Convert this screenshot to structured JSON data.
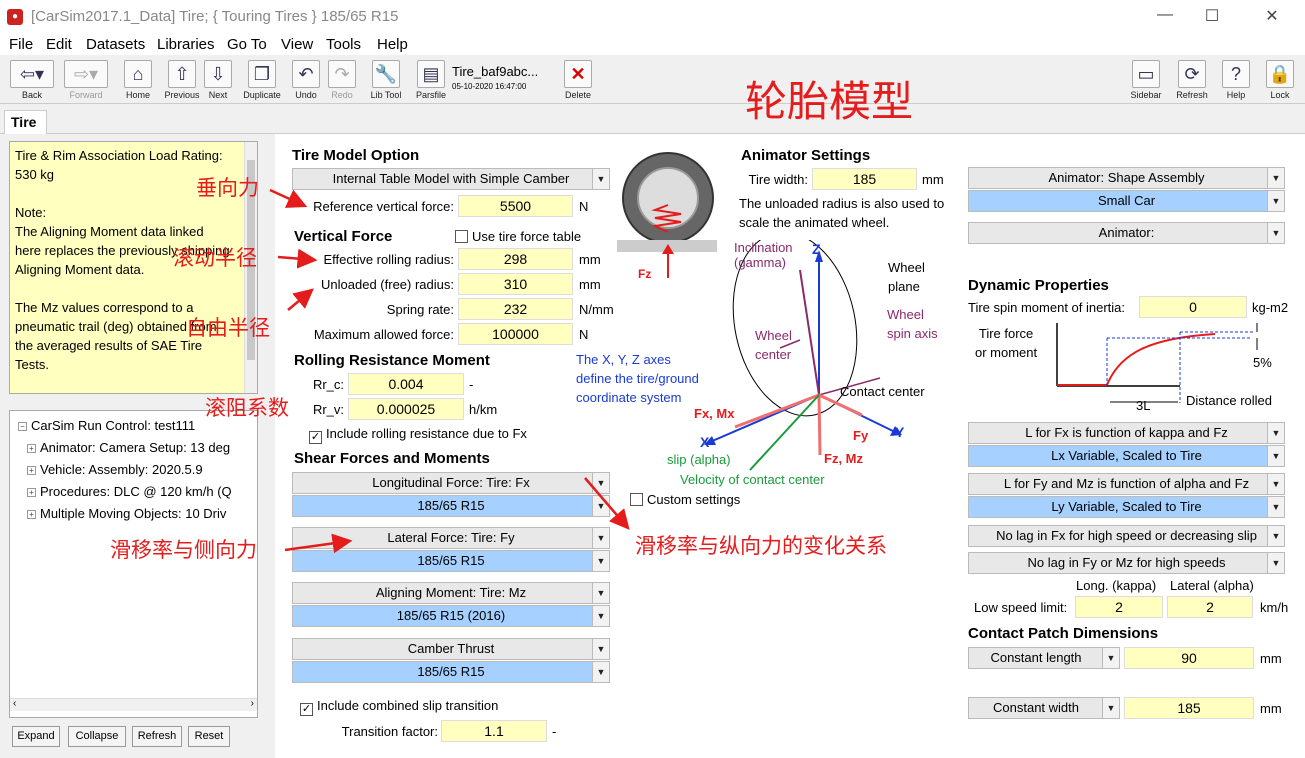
{
  "window": {
    "title": "[CarSim2017.1_Data] Tire; { Touring Tires } 185/65 R15",
    "app_icon": "carsim-icon"
  },
  "menu": [
    "File",
    "Edit",
    "Datasets",
    "Libraries",
    "Go To",
    "View",
    "Tools",
    "Help"
  ],
  "toolbar": {
    "back": "Back",
    "forward": "Forward",
    "home": "Home",
    "previous": "Previous",
    "next": "Next",
    "duplicate": "Duplicate",
    "undo": "Undo",
    "redo": "Redo",
    "libtool": "Lib Tool",
    "parsfile": "Parsfile",
    "dataset_name": "Tire_baf9abc...",
    "dataset_date": "05-10-2020 16:47:00",
    "delete": "Delete",
    "sidebar": "Sidebar",
    "refresh": "Refresh",
    "help": "Help",
    "lock": "Lock"
  },
  "tab": "Tire",
  "notes": {
    "l1": "Tire & Rim Association Load Rating:",
    "l2": "530 kg",
    "l3": "Note:",
    "l4": "The Aligning Moment data linked",
    "l5": "here replaces the previously shipping",
    "l6": "Aligning Moment data.",
    "l7": "The Mz values correspond to a",
    "l8": "pneumatic trail (deg) obtained from",
    "l9": "the averaged results of SAE Tire",
    "l10": "Tests."
  },
  "tree": {
    "root": "CarSim Run Control: test111",
    "items": [
      "Animator: Camera Setup: 13 deg",
      "Vehicle: Assembly: 2020.5.9",
      "Procedures: DLC @ 120 km/h (Q",
      "Multiple Moving Objects: 10 Driv"
    ]
  },
  "tree_buttons": {
    "expand": "Expand",
    "collapse": "Collapse",
    "refresh": "Refresh",
    "reset": "Reset"
  },
  "annotations": {
    "big_title": "轮胎模型",
    "vertical_force": "垂向力",
    "rolling_radius": "滚动半径",
    "free_radius": "自由半径",
    "rolling_coef": "滚阻系数",
    "slip_lateral": "滑移率与侧向力",
    "slip_longitudinal": "滑移率与纵向力的变化关系"
  },
  "tire_model": {
    "heading": "Tire Model Option",
    "option": "Internal Table Model with Simple Camber",
    "ref_force_label": "Reference vertical force:",
    "ref_force": "5500",
    "ref_force_unit": "N"
  },
  "vertical": {
    "heading": "Vertical Force",
    "use_table": "Use tire force table",
    "eff_label": "Effective rolling radius:",
    "eff": "298",
    "eff_unit": "mm",
    "unl_label": "Unloaded (free) radius:",
    "unl": "310",
    "unl_unit": "mm",
    "spring_label": "Spring rate:",
    "spring": "232",
    "spring_unit": "N/mm",
    "max_label": "Maximum allowed force:",
    "max": "100000",
    "max_unit": "N"
  },
  "rolling": {
    "heading": "Rolling Resistance Moment",
    "rrc_label": "Rr_c:",
    "rrc": "0.004",
    "rrc_unit": "-",
    "rrv_label": "Rr_v:",
    "rrv": "0.000025",
    "rrv_unit": "h/km",
    "include": "Include rolling resistance due to Fx"
  },
  "shear": {
    "heading": "Shear Forces and Moments",
    "fx_title": "Longitudinal Force: Tire: Fx",
    "fx": "185/65 R15",
    "fy_title": "Lateral Force: Tire: Fy",
    "fy": "185/65 R15",
    "mz_title": "Aligning Moment: Tire: Mz",
    "mz": "185/65 R15 (2016)",
    "camber_title": "Camber Thrust",
    "camber": "185/65 R15",
    "combined": "Include combined slip transition",
    "trans_label": "Transition factor:",
    "trans": "1.1",
    "trans_unit": "-"
  },
  "diagram": {
    "fz": "Fz",
    "inclination": "Inclination",
    "gamma": "(gamma)",
    "z": "Z",
    "wheel_plane": "Wheel",
    "wheel_plane2": "plane",
    "wheel_spin": "Wheel",
    "wheel_spin2": "spin axis",
    "wheel_center": "Wheel",
    "wheel_center2": "center",
    "axes_note1": "The X, Y, Z axes",
    "axes_note2": "define the tire/ground",
    "axes_note3": "coordinate system",
    "contact": "Contact center",
    "fxmx": "Fx, Mx",
    "fy": "Fy",
    "y": "Y",
    "x": "X",
    "slip": "slip (alpha)",
    "fzmz": "Fz, Mz",
    "velocity": "Velocity of contact center",
    "custom": "Custom settings"
  },
  "animator": {
    "heading": "Animator Settings",
    "width_label": "Tire width:",
    "width": "185",
    "width_unit": "mm",
    "note1": "The unloaded radius is also used to",
    "note2": "scale the animated wheel.",
    "shape_title": "Animator: Shape Assembly",
    "shape": "Small Car",
    "animator": "Animator:"
  },
  "dynamic": {
    "heading": "Dynamic Properties",
    "inertia_label": "Tire spin moment of inertia:",
    "inertia": "0",
    "inertia_unit": "kg-m2",
    "force_label1": "Tire force",
    "force_label2": "or moment",
    "pct": "5%",
    "three_l": "3L",
    "distance": "Distance rolled",
    "lfx_title": "L for Fx is function of kappa and Fz",
    "lfx": "Lx Variable, Scaled to Tire",
    "lfy_title": "L for Fy and Mz is function of alpha and Fz",
    "lfy": "Ly Variable, Scaled to Tire",
    "nolag_fx": "No lag in Fx for high speed or decreasing slip",
    "nolag_fy": "No lag in Fy or Mz for high speeds",
    "long_head": "Long. (kappa)",
    "lat_head": "Lateral (alpha)",
    "low_label": "Low speed limit:",
    "low_long": "2",
    "low_lat": "2",
    "low_unit": "km/h"
  },
  "contact": {
    "heading": "Contact Patch Dimensions",
    "len_mode": "Constant length",
    "len": "90",
    "len_unit": "mm",
    "wid_mode": "Constant width",
    "wid": "185",
    "wid_unit": "mm"
  },
  "colors": {
    "accent_red": "#e51c1c",
    "field_yellow": "#ffffc0",
    "dataset_blue": "#a5d0ff"
  }
}
